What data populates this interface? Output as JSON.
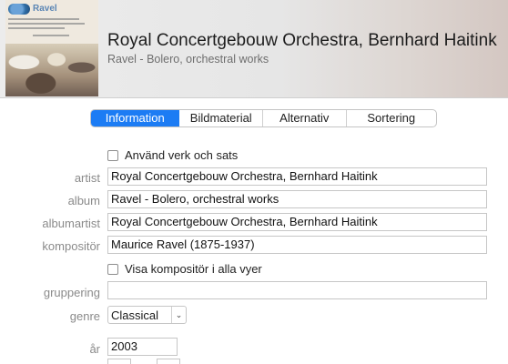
{
  "header": {
    "title": "Royal Concertgebouw Orchestra, Bernhard Haitink",
    "subtitle": "Ravel - Bolero, orchestral works",
    "artwork": {
      "title": "Ravel",
      "icon": "album-artwork-image"
    }
  },
  "tabs": [
    {
      "label": "Information",
      "active": true
    },
    {
      "label": "Bildmaterial",
      "active": false
    },
    {
      "label": "Alternativ",
      "active": false
    },
    {
      "label": "Sortering",
      "active": false
    }
  ],
  "checkboxes": {
    "work_and_movement": {
      "label": "Använd verk och sats",
      "checked": false
    },
    "show_composer": {
      "label": "Visa kompositör i alla vyer",
      "checked": false
    }
  },
  "fields": {
    "artist": {
      "label": "artist",
      "value": "Royal Concertgebouw Orchestra, Bernhard Haitink"
    },
    "album": {
      "label": "album",
      "value": "Ravel - Bolero, orchestral works"
    },
    "albumartist": {
      "label": "albumartist",
      "value": "Royal Concertgebouw Orchestra, Bernhard Haitink"
    },
    "composer": {
      "label": "kompositör",
      "value": "Maurice Ravel (1875-1937)"
    },
    "grouping": {
      "label": "gruppering",
      "value": ""
    },
    "genre": {
      "label": "genre",
      "value": "Classical"
    },
    "year": {
      "label": "år",
      "value": "2003"
    }
  },
  "colors": {
    "accent": "#1c7cf4",
    "label_gray": "#8a8a8a"
  }
}
